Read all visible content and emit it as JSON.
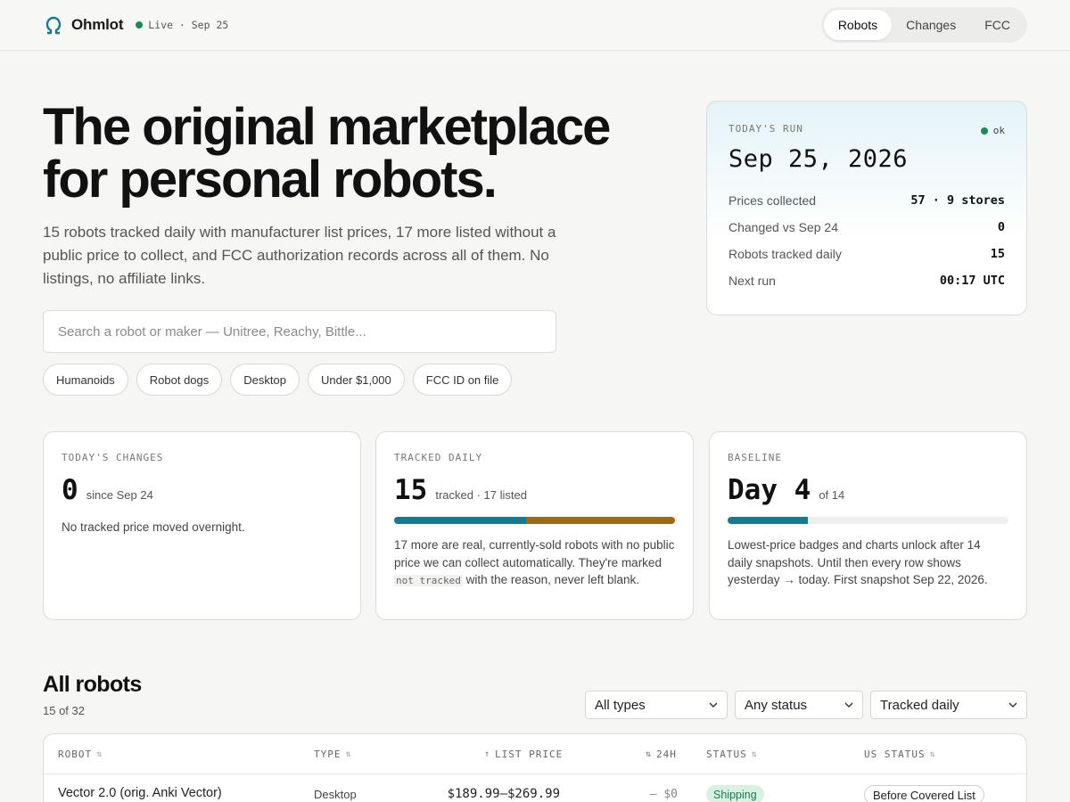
{
  "header": {
    "brand": "Ohmlot",
    "live_status": "Live · Sep 25",
    "nav": [
      {
        "label": "Robots",
        "active": true
      },
      {
        "label": "Changes",
        "active": false
      },
      {
        "label": "FCC",
        "active": false
      }
    ]
  },
  "hero": {
    "title_line1": "The original marketplace",
    "title_line2": "for personal robots.",
    "subtitle": "15 robots tracked daily with manufacturer list prices, 17 more listed without a public price to collect, and FCC authorization records across all of them. No listings, no affiliate links.",
    "search_placeholder": "Search a robot or maker — Unitree, Reachy, Bittle...",
    "chips": [
      "Humanoids",
      "Robot dogs",
      "Desktop",
      "Under $1,000",
      "FCC ID on file"
    ]
  },
  "run_card": {
    "label": "TODAY'S RUN",
    "status": "ok",
    "date": "Sep 25, 2026",
    "rows": [
      {
        "label": "Prices collected",
        "value": "57 · 9 stores"
      },
      {
        "label": "Changed vs Sep 24",
        "value": "0"
      },
      {
        "label": "Robots tracked daily",
        "value": "15"
      },
      {
        "label": "Next run",
        "value": "00:17 UTC"
      }
    ]
  },
  "stats": {
    "changes": {
      "label": "TODAY'S CHANGES",
      "number": "0",
      "suffix": "since Sep 24",
      "desc": "No tracked price moved overnight."
    },
    "tracked": {
      "label": "TRACKED DAILY",
      "number": "15",
      "suffix": "tracked · 17 listed",
      "tracked_count": 15,
      "listed_count": 17,
      "desc_before": "17 more are real, currently-sold robots with no public price we can collect automatically. They're marked",
      "desc_code": "not tracked",
      "desc_after": "with the reason, never left blank."
    },
    "baseline": {
      "label": "BASELINE",
      "number": "Day 4",
      "suffix": "of 14",
      "day": 4,
      "total_days": 14,
      "desc": "Lowest-price badges and charts unlock after 14 daily snapshots. Until then every row shows yesterday → today. First snapshot Sep 22, 2026."
    }
  },
  "robots": {
    "title": "All robots",
    "count": "15 of 32",
    "filters": [
      "All types",
      "Any status",
      "Tracked daily"
    ],
    "columns": {
      "robot": "ROBOT",
      "type": "TYPE",
      "list_price": "LIST PRICE",
      "change_24h": "24H",
      "status": "STATUS",
      "us_status": "US STATUS"
    },
    "rows": [
      {
        "robot": "Vector 2.0 (orig. Anki Vector)",
        "type": "Desktop",
        "list_price": "$189.99–$269.99",
        "change_24h": "— $0",
        "status": "Shipping",
        "us_status": "Before Covered List"
      }
    ]
  },
  "colors": {
    "accent_teal": "#177a91",
    "accent_amber": "#9c6a16",
    "status_green": "#1a8a5a"
  }
}
